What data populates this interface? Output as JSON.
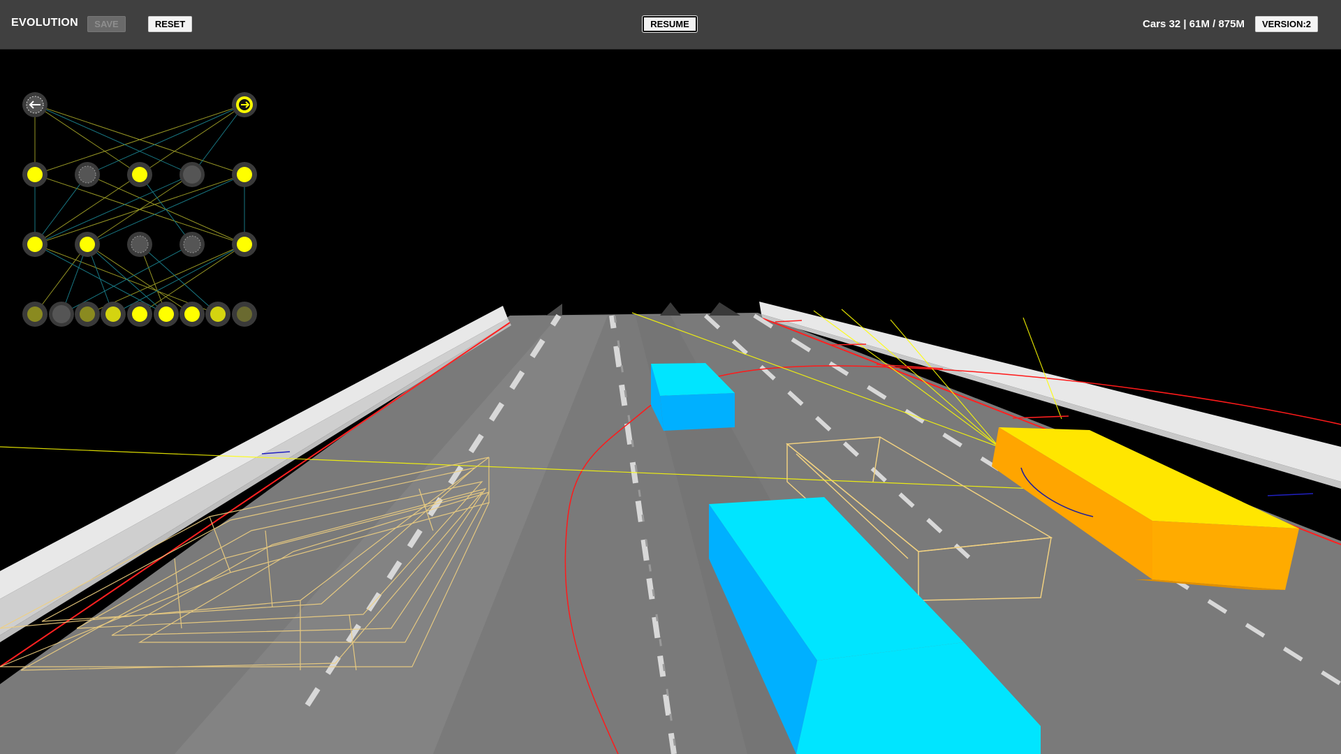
{
  "toolbar": {
    "title": "EVOLUTION",
    "save_label": "SAVE",
    "reset_label": "RESET",
    "resume_label": "RESUME",
    "stats": "Cars 32 | 61M / 875M",
    "version_label": "VERSION:2"
  },
  "colors": {
    "toolbar_bg": "#404040",
    "sky": "#000000",
    "road": "#7a7a7a",
    "barrier": "#e6e6e6",
    "traffic_car": "#00e5ff",
    "ego_car": "#ffa500",
    "ego_car_top": "#ffe600",
    "sensor_ray": "#ffff00",
    "path_line": "#ff0000",
    "ghost_car": "#f0d080"
  },
  "network": {
    "layers": [
      {
        "name": "output",
        "nodes": [
          "left-arrow-icon",
          "right-arrow-icon"
        ]
      },
      {
        "name": "hidden-2",
        "nodes": [
          1,
          0,
          1,
          0,
          1
        ]
      },
      {
        "name": "hidden-1",
        "nodes": [
          1,
          1,
          0,
          0,
          1
        ]
      },
      {
        "name": "input",
        "nodes": [
          0.5,
          0,
          0.5,
          0.8,
          1,
          1,
          1,
          0.8,
          0.4
        ]
      }
    ]
  }
}
